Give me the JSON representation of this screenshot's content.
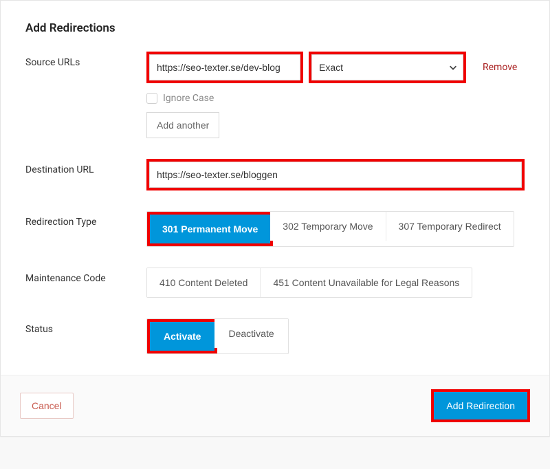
{
  "dialog": {
    "title": "Add Redirections"
  },
  "source": {
    "label": "Source URLs",
    "url_value": "https://seo-texter.se/dev-blog",
    "match_value": "Exact",
    "remove_label": "Remove",
    "ignore_case_label": "Ignore Case",
    "add_another_label": "Add another"
  },
  "destination": {
    "label": "Destination URL",
    "url_value": "https://seo-texter.se/bloggen"
  },
  "redirection_type": {
    "label": "Redirection Type",
    "options": {
      "r301": "301 Permanent Move",
      "r302": "302 Temporary Move",
      "r307": "307 Temporary Redirect"
    }
  },
  "maintenance": {
    "label": "Maintenance Code",
    "options": {
      "r410": "410 Content Deleted",
      "r451": "451 Content Unavailable for Legal Reasons"
    }
  },
  "status": {
    "label": "Status",
    "activate": "Activate",
    "deactivate": "Deactivate"
  },
  "footer": {
    "cancel": "Cancel",
    "submit": "Add Redirection"
  }
}
